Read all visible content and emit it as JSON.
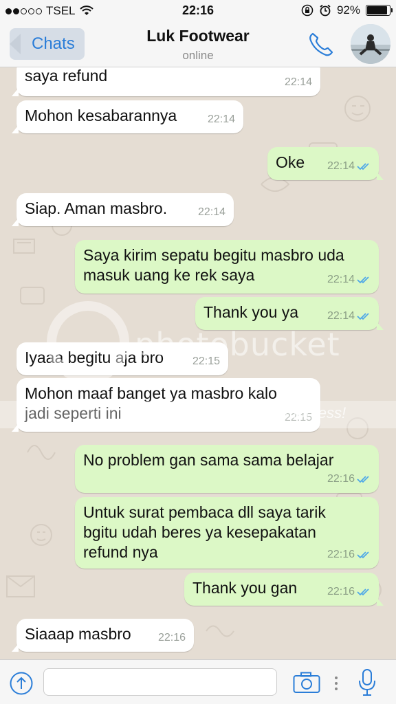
{
  "status_bar": {
    "carrier": "TSEL",
    "time": "22:16",
    "battery": "92%",
    "battery_level": 0.92
  },
  "header": {
    "back_label": "Chats",
    "contact_name": "Luk Footwear",
    "contact_status": "online"
  },
  "messages": [
    {
      "dir": "in",
      "lines": [
        "saya refund"
      ],
      "time": "22:14"
    },
    {
      "dir": "in",
      "lines": [
        "Mohon kesabarannya"
      ],
      "time": "22:14"
    },
    {
      "dir": "out",
      "lines": [
        "Oke"
      ],
      "time": "22:14"
    },
    {
      "dir": "in",
      "lines": [
        "Siap. Aman masbro."
      ],
      "time": "22:14"
    },
    {
      "dir": "out",
      "lines": [
        "Saya kirim sepatu begitu masbro uda",
        "masuk uang ke rek saya"
      ],
      "time": "22:14"
    },
    {
      "dir": "out",
      "lines": [
        "Thank you ya"
      ],
      "time": "22:14"
    },
    {
      "dir": "in",
      "lines": [
        "Iyaaa begitu aja bro"
      ],
      "time": "22:15"
    },
    {
      "dir": "in",
      "lines": [
        "Mohon maaf banget ya masbro kalo",
        "jadi seperti ini"
      ],
      "time": "22:15"
    },
    {
      "dir": "out",
      "lines": [
        "No problem gan sama sama belajar"
      ],
      "time": "22:16"
    },
    {
      "dir": "out",
      "lines": [
        "Untuk surat pembaca dll saya tarik",
        "bgitu udah beres ya kesepakatan",
        "refund nya"
      ],
      "time": "22:16"
    },
    {
      "dir": "out",
      "lines": [
        "Thank you gan"
      ],
      "time": "22:16"
    },
    {
      "dir": "in",
      "lines": [
        "Siaaap masbro"
      ],
      "time": "22:16"
    }
  ],
  "watermark": {
    "brand": "photobucket",
    "tagline": "of your memories for less!"
  },
  "colors": {
    "incoming": "#ffffff",
    "outgoing": "#dcf8c6",
    "accent": "#2a7dd8",
    "read_ticks": "#4fa8e8"
  },
  "icons": {
    "phone": "phone-icon",
    "upload": "upload-icon",
    "camera": "camera-icon",
    "more": "more-icon",
    "mic": "microphone-icon"
  }
}
